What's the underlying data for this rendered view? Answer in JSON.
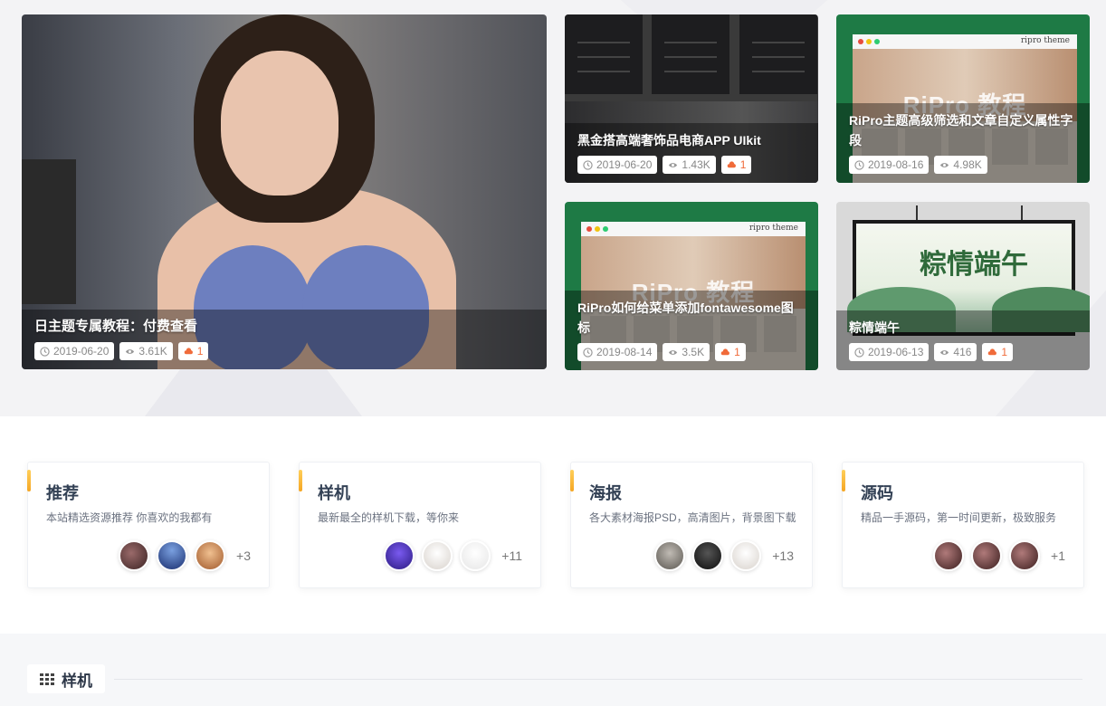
{
  "hero": {
    "featured": {
      "title": "日主题专属教程：付费查看",
      "date": "2019-06-20",
      "views": "3.61K",
      "hot": "1"
    },
    "items": [
      {
        "title": "黑金搭高端奢饰品电商APP UIkit",
        "date": "2019-06-20",
        "views": "1.43K",
        "hot": "1"
      },
      {
        "title": "RiPro主题高级筛选和文章自定义属性字段",
        "date": "2019-08-16",
        "views": "4.98K",
        "hot": null,
        "thumb_logo": "RiPro 教程",
        "thumb_brand": "ripro theme"
      },
      {
        "title": "RiPro如何给菜单添加fontawesome图标",
        "date": "2019-08-14",
        "views": "3.5K",
        "hot": "1",
        "thumb_logo": "RiPro 教程",
        "thumb_brand": "ripro theme"
      },
      {
        "title": "粽情端午",
        "date": "2019-06-13",
        "views": "416",
        "hot": "1",
        "thumb_text": "粽情端午"
      }
    ]
  },
  "categories": [
    {
      "title": "推荐",
      "desc": "本站精选资源推荐 你喜欢的我都有",
      "more": "+3",
      "avatar_colors": [
        "#5a3a3a",
        "#2e4f9a",
        "#c0783a"
      ]
    },
    {
      "title": "样机",
      "desc": "最新最全的样机下载，等你来",
      "more": "+11",
      "avatar_colors": [
        "#4b2fa8",
        "#e8e4e0",
        "#f1f1f1"
      ]
    },
    {
      "title": "海报",
      "desc": "各大素材海报PSD，高清图片，背景图下载",
      "more": "+13",
      "avatar_colors": [
        "#8a8680",
        "#1c1c1c",
        "#e8e4e0"
      ]
    },
    {
      "title": "源码",
      "desc": "精品一手源码，第一时间更新，极致服务",
      "more": "+1",
      "avatar_colors": [
        "#6b3a3a",
        "#6b3a3a",
        "#6b3a3a"
      ]
    }
  ],
  "section": {
    "title": "样机"
  },
  "colors": {
    "accent": "#f5a623",
    "hot": "#f06b3a",
    "green": "#1e7a45"
  }
}
